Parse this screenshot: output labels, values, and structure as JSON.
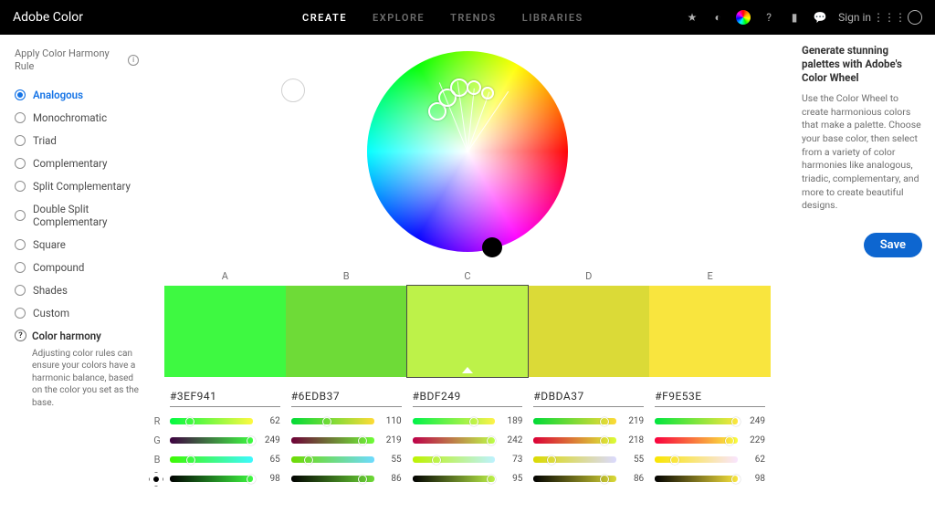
{
  "brand": "Adobe Color",
  "nav": {
    "create": "CREATE",
    "explore": "EXPLORE",
    "trends": "TRENDS",
    "libraries": "LIBRARIES"
  },
  "auth": {
    "signin": "Sign in"
  },
  "sidebar": {
    "title": "Apply Color Harmony Rule",
    "rules": [
      "Analogous",
      "Monochromatic",
      "Triad",
      "Complementary",
      "Split Complementary",
      "Double Split Complementary",
      "Square",
      "Compound",
      "Shades",
      "Custom"
    ],
    "help_title": "Color harmony",
    "help_text": "Adjusting color rules can ensure your colors have a harmonic balance, based on the color you set as the base."
  },
  "swatch_labels": [
    "A",
    "B",
    "C",
    "D",
    "E"
  ],
  "swatches": [
    {
      "hex": "#3EF941",
      "r": 62,
      "g": 249,
      "b": 65,
      "br": 98
    },
    {
      "hex": "#6EDB37",
      "r": 110,
      "g": 219,
      "b": 55,
      "br": 86
    },
    {
      "hex": "#BDF249",
      "r": 189,
      "g": 242,
      "b": 73,
      "br": 95
    },
    {
      "hex": "#DBDA37",
      "r": 219,
      "g": 218,
      "b": 55,
      "br": 86
    },
    {
      "hex": "#F9E53E",
      "r": 249,
      "g": 229,
      "b": 62,
      "br": 98
    }
  ],
  "channels": {
    "r": "R",
    "g": "G",
    "b": "B"
  },
  "panel": {
    "title": "Generate stunning palettes with Adobe's Color Wheel",
    "body": "Use the Color Wheel to create harmonious colors that make a palette. Choose your base color, then select from a variety of color harmonies like analogous, triadic, complementary, and more to create beautiful designs.",
    "save": "Save"
  }
}
